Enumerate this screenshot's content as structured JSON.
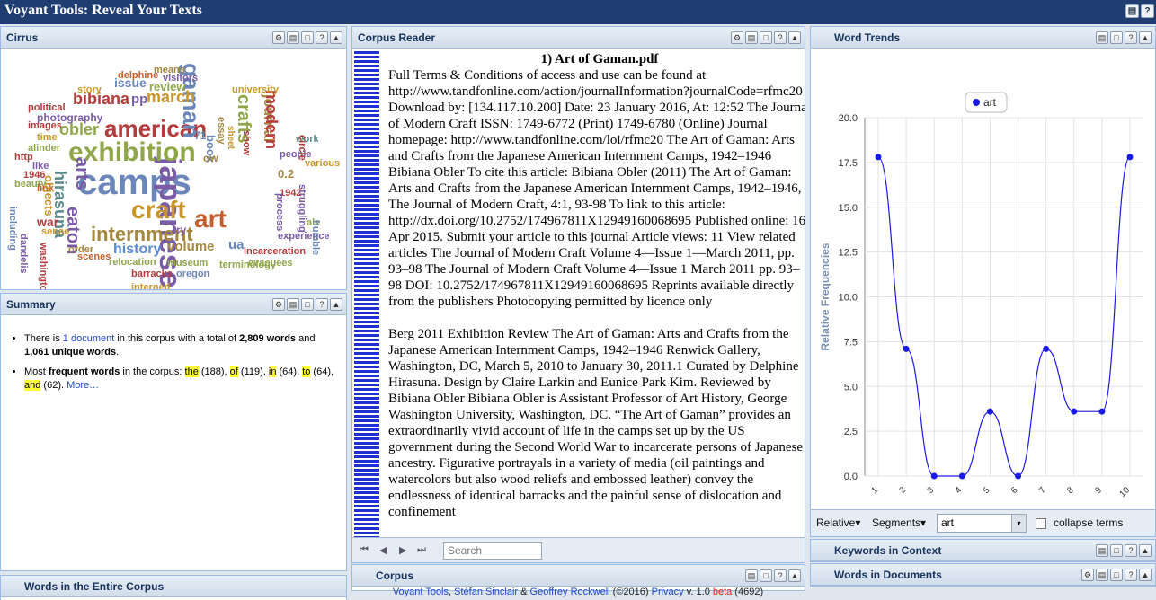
{
  "app": {
    "title": "Voyant Tools: Reveal Your Texts",
    "btn_a": "▤",
    "btn_b": "?"
  },
  "tools": {
    "gear": "⚙",
    "save": "▤",
    "window": "□",
    "help": "?",
    "collapse": "▲"
  },
  "cirrus": {
    "title": "Cirrus",
    "words": [
      {
        "t": "camps",
        "c": "#6b86b9"
      },
      {
        "t": "japanese",
        "c": "#7a5ba6"
      },
      {
        "t": "exhibition",
        "c": "#8fa64a"
      },
      {
        "t": "american",
        "c": "#b43b3b"
      },
      {
        "t": "art",
        "c": "#c65c2a"
      },
      {
        "t": "craft",
        "c": "#c9952a"
      },
      {
        "t": "internment",
        "c": "#a4873d"
      },
      {
        "t": "gaman",
        "c": "#6b86b9"
      },
      {
        "t": "arts",
        "c": "#7a5ba6"
      },
      {
        "t": "hirasuna",
        "c": "#5a8a8a"
      },
      {
        "t": "eaton",
        "c": "#7a5ba6"
      },
      {
        "t": "history",
        "c": "#5a8ad0"
      },
      {
        "t": "crafts",
        "c": "#8fa64a"
      },
      {
        "t": "journal",
        "c": "#a4873d"
      },
      {
        "t": "modern",
        "c": "#b43b3b"
      },
      {
        "t": "bibiana",
        "c": "#b43b3b"
      },
      {
        "t": "obler",
        "c": "#8fa64a"
      },
      {
        "t": "march",
        "c": "#c9952a"
      },
      {
        "t": "issue",
        "c": "#6b86b9"
      },
      {
        "t": "review",
        "c": "#8fa64a"
      },
      {
        "t": "pp",
        "c": "#7a5ba6"
      },
      {
        "t": "volume",
        "c": "#a4873d"
      },
      {
        "t": "museum",
        "c": "#8fa64a"
      },
      {
        "t": "relocation",
        "c": "#8fa64a"
      },
      {
        "t": "barracks",
        "c": "#b43b3b"
      },
      {
        "t": "interned",
        "c": "#c9952a"
      },
      {
        "t": "oregon",
        "c": "#6b86b9"
      },
      {
        "t": "terminology",
        "c": "#8fa64a"
      },
      {
        "t": "incarceration",
        "c": "#b43b3b"
      },
      {
        "t": "ua",
        "c": "#6b86b9"
      },
      {
        "t": "photography",
        "c": "#7a5ba6"
      },
      {
        "t": "political",
        "c": "#b43b3b"
      },
      {
        "t": "delphine",
        "c": "#c65c2a"
      },
      {
        "t": "visitors",
        "c": "#7a5ba6"
      },
      {
        "t": "means",
        "c": "#a4873d"
      },
      {
        "t": "university",
        "c": "#c9952a"
      },
      {
        "t": "book",
        "c": "#6b86b9"
      },
      {
        "t": "1942",
        "c": "#b43b3b"
      },
      {
        "t": "people",
        "c": "#7a5ba6"
      },
      {
        "t": "work",
        "c": "#5a8a8a"
      },
      {
        "t": "various",
        "c": "#c9952a"
      },
      {
        "t": "experience",
        "c": "#7a5ba6"
      },
      {
        "t": "process",
        "c": "#7a5ba6"
      },
      {
        "t": "scenes",
        "c": "#c65c2a"
      },
      {
        "t": "order",
        "c": "#a4873d"
      },
      {
        "t": "evacuees",
        "c": "#8fa64a"
      },
      {
        "t": "images",
        "c": "#b43b3b"
      },
      {
        "t": "story",
        "c": "#c9952a"
      },
      {
        "t": "alinder",
        "c": "#8fa64a"
      },
      {
        "t": "time",
        "c": "#c9952a"
      },
      {
        "t": "1946",
        "c": "#b43b3b"
      },
      {
        "t": "http",
        "c": "#b43b3b"
      },
      {
        "t": "like",
        "c": "#7a5ba6"
      },
      {
        "t": "beauty",
        "c": "#8fa64a"
      },
      {
        "t": "link",
        "c": "#c65c2a"
      },
      {
        "t": "war",
        "c": "#b43b3b"
      },
      {
        "t": "sense",
        "c": "#c9952a"
      },
      {
        "t": "objects",
        "c": "#c9952a"
      },
      {
        "t": "0.2",
        "c": "#a4873d"
      },
      {
        "t": "71",
        "c": "#6b86b9"
      },
      {
        "t": "ow",
        "c": "#a4873d"
      },
      {
        "t": "ry",
        "c": "#7a5ba6"
      },
      {
        "t": "show",
        "c": "#b43b3b"
      },
      {
        "t": "essay",
        "c": "#a4873d"
      },
      {
        "t": "circle",
        "c": "#b43b3b"
      },
      {
        "t": "including",
        "c": "#6b86b9"
      },
      {
        "t": "dandelis",
        "c": "#7a5ba6"
      },
      {
        "t": "washington",
        "c": "#b43b3b"
      },
      {
        "t": "ale",
        "c": "#8fa64a"
      },
      {
        "t": "struggling",
        "c": "#7a5ba6"
      },
      {
        "t": "humble",
        "c": "#6b86b9"
      },
      {
        "t": "sheet",
        "c": "#c9952a"
      }
    ]
  },
  "summary": {
    "title": "Summary",
    "l1_a": "There is ",
    "l1_link": "1 document",
    "l1_b": " in this corpus with a total of ",
    "l1_words": "2,809 words",
    "l1_c": " and ",
    "l1_unique": "1,061 unique words",
    "l1_d": ".",
    "l2_a": "Most ",
    "l2_bold": "frequent words",
    "l2_b": " in the corpus: ",
    "f1": "the",
    "f1n": " (188), ",
    "f2": "of",
    "f2n": " (119), ",
    "f3": "in",
    "f3n": " (64), ",
    "f4": "to",
    "f4n": " (64), ",
    "f5": "and",
    "f5n": " (62). ",
    "more": "More…"
  },
  "words_panel": {
    "title": "Words in the Entire Corpus"
  },
  "reader": {
    "title": "Corpus Reader",
    "doc_title": "1) Art of Gaman.pdf",
    "p1": "Full Terms & Conditions of access and use can be found at http://www.tandfonline.com/action/journalInformation?journalCode=rfmc20 Download by: [134.117.10.200] Date: 23 January 2016, At: 12:52 The Journal of Modern Craft ISSN: 1749-6772 (Print) 1749-6780 (Online) Journal homepage: http://www.tandfonline.com/loi/rfmc20 The Art of Gaman: Arts and Crafts from the Japanese American Internment Camps, 1942–1946 Bibiana Obler To cite this article: Bibiana Obler (2011) The Art of Gaman: Arts and Crafts from the Japanese American Internment Camps, 1942–1946, The Journal of Modern Craft, 4:1, 93-98 To link to this article: http://dx.doi.org/10.2752/174967811X12949160068695 Published online: 16 Apr 2015. Submit your article to this journal Article views: 11 View related articles The Journal of Modern Craft Volume 4—Issue 1—March 2011, pp. 93–98 The Journal of Modern Craft Volume 4—Issue 1 March 2011 pp. 93–98 DOI: 10.2752/174967811X12949160068695 Reprints available directly from the publishers Photocopying permitted by licence only",
    "p2": "Berg 2011 Exhibition Review The Art of Gaman: Arts and Crafts from the Japanese American Internment Camps, 1942–1946 Renwick Gallery, Washington, DC, March 5, 2010 to January 30, 2011.1 Curated by Delphine Hirasuna. Design by Claire Larkin and Eunice Park Kim. Reviewed by Bibiana Obler Bibiana Obler is Assistant Professor of Art History, George Washington University, Washington, DC. “The Art of Gaman” provides an extraordinarily vivid account of life in the camps set up by the US government during the Second World War to incarcerate persons of Japanese ancestry. Figurative portrayals in a variety of media (oil paintings and watercolors but also wood reliefs and embossed leather) convey the endlessness of identical barracks and the painful sense of dislocation and confinement",
    "search_placeholder": "Search",
    "nav_first": "⏮",
    "nav_prev": "◀",
    "nav_next": "▶",
    "nav_last": "⏭"
  },
  "corpus_panel": {
    "title": "Corpus"
  },
  "trends": {
    "title": "Word Trends",
    "legend": "art",
    "ylabel": "Relative Frequencies",
    "relative": "Relative",
    "segments": "Segments",
    "word": "art",
    "collapse": "collapse terms",
    "caret": "▾"
  },
  "kwic_panel": {
    "title": "Keywords in Context"
  },
  "docs_panel": {
    "title": "Words in Documents"
  },
  "status": {
    "a": "Voyant Tools",
    "b": ", ",
    "c": "Stéfan Sinclair",
    "d": " & ",
    "e": "Geoffrey Rockwell",
    "f": " (©2016) ",
    "g": "Privacy",
    "h": " v. 1.0 ",
    "i": "beta",
    "j": " (4692)"
  },
  "chart_data": {
    "type": "line",
    "x": [
      1,
      2,
      3,
      4,
      5,
      6,
      7,
      8,
      9,
      10
    ],
    "series": [
      {
        "name": "art",
        "values": [
          17.8,
          7.1,
          0,
          0,
          3.6,
          0,
          7.1,
          3.6,
          3.6,
          17.8
        ],
        "color": "#1a1ae6"
      }
    ],
    "yticks": [
      "0.0",
      "2.5",
      "5.0",
      "7.5",
      "10.0",
      "12.5",
      "15.0",
      "17.5",
      "20.0"
    ],
    "ylim": [
      0,
      20
    ],
    "ylabel": "Relative Frequencies",
    "grid": true,
    "legend": "top-center"
  }
}
